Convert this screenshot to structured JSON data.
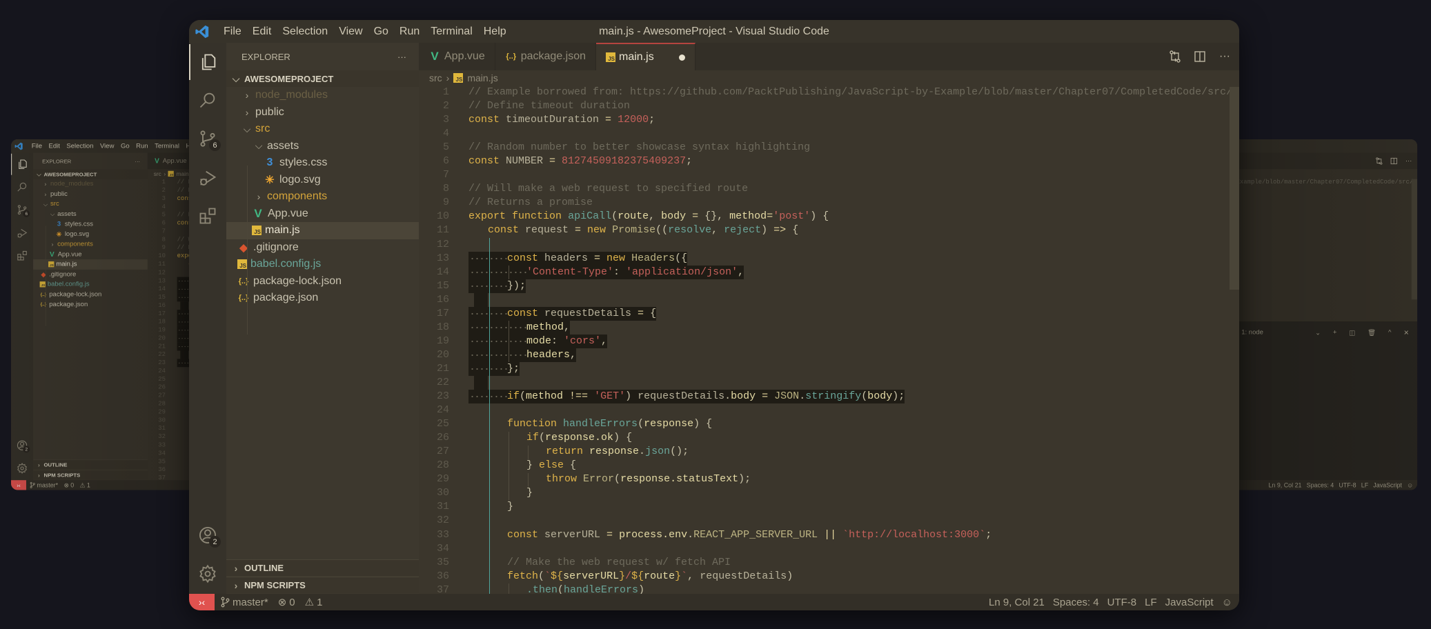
{
  "window": {
    "title": "main.js - AwesomeProject - Visual Studio Code",
    "menu": [
      "File",
      "Edit",
      "Selection",
      "View",
      "Go",
      "Run",
      "Terminal",
      "Help"
    ]
  },
  "activity_bar": {
    "items": [
      {
        "name": "explorer",
        "active": true
      },
      {
        "name": "search"
      },
      {
        "name": "source-control",
        "badge": "6"
      },
      {
        "name": "run-debug"
      },
      {
        "name": "extensions"
      }
    ],
    "account_badge": "2"
  },
  "sidebar": {
    "title": "EXPLORER",
    "more": "···",
    "project": "AWESOMEPROJECT",
    "tree": [
      {
        "label": "node_modules",
        "depth": 1,
        "kind": "folder",
        "expanded": false,
        "color": "#6b6045"
      },
      {
        "label": "public",
        "depth": 1,
        "kind": "folder",
        "expanded": false,
        "color": "#c9c3b0"
      },
      {
        "label": "src",
        "depth": 1,
        "kind": "folder",
        "expanded": true,
        "color": "#d4a43a"
      },
      {
        "label": "assets",
        "depth": 2,
        "kind": "folder",
        "expanded": true,
        "color": "#c9c3b0"
      },
      {
        "label": "styles.css",
        "depth": 3,
        "kind": "file",
        "icon": "css",
        "color": "#c9c3b0"
      },
      {
        "label": "logo.svg",
        "depth": 3,
        "kind": "file",
        "icon": "svg",
        "color": "#c9c3b0"
      },
      {
        "label": "components",
        "depth": 2,
        "kind": "folder",
        "expanded": false,
        "color": "#d4a43a"
      },
      {
        "label": "App.vue",
        "depth": 2,
        "kind": "file",
        "icon": "vue",
        "color": "#c9c3b0"
      },
      {
        "label": "main.js",
        "depth": 2,
        "kind": "file",
        "icon": "js",
        "color": "#ece6d4",
        "selected": true
      },
      {
        "label": ".gitignore",
        "depth": 1,
        "kind": "file",
        "icon": "git",
        "color": "#c9c3b0"
      },
      {
        "label": "babel.config.js",
        "depth": 1,
        "kind": "file",
        "icon": "js",
        "color": "#6aa69a"
      },
      {
        "label": "package-lock.json",
        "depth": 1,
        "kind": "file",
        "icon": "json",
        "color": "#c9c3b0"
      },
      {
        "label": "package.json",
        "depth": 1,
        "kind": "file",
        "icon": "json",
        "color": "#c9c3b0"
      }
    ],
    "sections": [
      "OUTLINE",
      "NPM SCRIPTS"
    ]
  },
  "tabs": [
    {
      "label": "App.vue",
      "icon": "vue"
    },
    {
      "label": "package.json",
      "icon": "json"
    },
    {
      "label": "main.js",
      "icon": "js",
      "active": true,
      "dirty": true
    }
  ],
  "breadcrumb": [
    "src",
    "main.js"
  ],
  "editor": {
    "lines": [
      {
        "n": "1",
        "i": 0,
        "t": [
          [
            "c",
            "// Example borrowed from: https://github.com/PacktPublishing/JavaScript-by-Example/blob/master/Chapter07/CompletedCode/src/se"
          ]
        ]
      },
      {
        "n": "2",
        "i": 0,
        "t": [
          [
            "c",
            "// Define timeout duration"
          ]
        ]
      },
      {
        "n": "3",
        "i": 0,
        "t": [
          [
            "k",
            "const"
          ],
          [
            "v",
            " timeoutDuration "
          ],
          [
            "o",
            "= "
          ],
          [
            "n",
            "12000"
          ],
          [
            "p",
            ";"
          ]
        ]
      },
      {
        "n": "4",
        "i": 0,
        "t": []
      },
      {
        "n": "5",
        "i": 0,
        "t": [
          [
            "c",
            "// Random number to better showcase syntax highlighting"
          ]
        ]
      },
      {
        "n": "6",
        "i": 0,
        "t": [
          [
            "k",
            "const"
          ],
          [
            "v",
            " NUMBER "
          ],
          [
            "o",
            "= "
          ],
          [
            "n",
            "81274509182375409237"
          ],
          [
            "p",
            ";"
          ]
        ]
      },
      {
        "n": "7",
        "i": 0,
        "t": []
      },
      {
        "n": "8",
        "i": 0,
        "t": [
          [
            "c",
            "// Will make a web request to specified route"
          ]
        ]
      },
      {
        "n": "9",
        "i": 0,
        "t": [
          [
            "c",
            "// Returns a promise"
          ]
        ]
      },
      {
        "n": "10",
        "i": 0,
        "t": [
          [
            "k",
            "export"
          ],
          [
            "p",
            " "
          ],
          [
            "k",
            "function"
          ],
          [
            "p",
            " "
          ],
          [
            "f",
            "apiCall"
          ],
          [
            "p",
            "("
          ],
          [
            "a",
            "route"
          ],
          [
            "p",
            ", "
          ],
          [
            "a",
            "body"
          ],
          [
            "o",
            " = "
          ],
          [
            "p",
            "{}, "
          ],
          [
            "a",
            "method"
          ],
          [
            "o",
            "="
          ],
          [
            "s",
            "'post'"
          ],
          [
            "p",
            ") {"
          ]
        ]
      },
      {
        "n": "11",
        "i": 1,
        "t": [
          [
            "k",
            "const"
          ],
          [
            "v",
            " request "
          ],
          [
            "o",
            "= "
          ],
          [
            "k",
            "new"
          ],
          [
            "p",
            " "
          ],
          [
            "t",
            "Promise"
          ],
          [
            "p",
            "(("
          ],
          [
            "f",
            "resolve"
          ],
          [
            "p",
            ", "
          ],
          [
            "f",
            "reject"
          ],
          [
            "p",
            ") "
          ],
          [
            "o",
            "=>"
          ],
          [
            "p",
            " {"
          ]
        ]
      },
      {
        "n": "12",
        "i": 0,
        "t": []
      },
      {
        "n": "13",
        "i": 2,
        "hl": true,
        "t": [
          [
            "k",
            "const"
          ],
          [
            "v",
            " headers "
          ],
          [
            "o",
            "= "
          ],
          [
            "k",
            "new"
          ],
          [
            "p",
            " "
          ],
          [
            "t",
            "Headers"
          ],
          [
            "p",
            "({"
          ]
        ]
      },
      {
        "n": "14",
        "i": 3,
        "hl": true,
        "t": [
          [
            "s",
            "'Content-Type'"
          ],
          [
            "p",
            ": "
          ],
          [
            "s",
            "'application/json'"
          ],
          [
            "p",
            ","
          ]
        ]
      },
      {
        "n": "15",
        "i": 2,
        "hl": true,
        "t": [
          [
            "p",
            "});"
          ]
        ]
      },
      {
        "n": "16",
        "i": 0,
        "strip": true,
        "t": []
      },
      {
        "n": "17",
        "i": 2,
        "hl": true,
        "t": [
          [
            "k",
            "const"
          ],
          [
            "v",
            " requestDetails "
          ],
          [
            "o",
            "= "
          ],
          [
            "p",
            "{"
          ]
        ]
      },
      {
        "n": "18",
        "i": 3,
        "hl": true,
        "t": [
          [
            "a",
            "method"
          ],
          [
            "p",
            ","
          ]
        ]
      },
      {
        "n": "19",
        "i": 3,
        "hl": true,
        "t": [
          [
            "a",
            "mode"
          ],
          [
            "p",
            ": "
          ],
          [
            "s",
            "'cors'"
          ],
          [
            "p",
            ","
          ]
        ]
      },
      {
        "n": "20",
        "i": 3,
        "hl": true,
        "t": [
          [
            "a",
            "headers"
          ],
          [
            "p",
            ","
          ]
        ]
      },
      {
        "n": "21",
        "i": 2,
        "hl": true,
        "t": [
          [
            "p",
            "};"
          ]
        ]
      },
      {
        "n": "22",
        "i": 0,
        "strip": true,
        "t": []
      },
      {
        "n": "23",
        "i": 2,
        "hl": true,
        "t": [
          [
            "k",
            "if"
          ],
          [
            "p",
            "("
          ],
          [
            "a",
            "method"
          ],
          [
            "o",
            " !== "
          ],
          [
            "s",
            "'GET'"
          ],
          [
            "p",
            ") "
          ],
          [
            "v",
            "requestDetails"
          ],
          [
            "p",
            "."
          ],
          [
            "a",
            "body"
          ],
          [
            "o",
            " = "
          ],
          [
            "t",
            "JSON"
          ],
          [
            "p",
            "."
          ],
          [
            "f",
            "stringify"
          ],
          [
            "p",
            "("
          ],
          [
            "a",
            "body"
          ],
          [
            "p",
            ");"
          ]
        ]
      },
      {
        "n": "24",
        "i": 0,
        "t": []
      },
      {
        "n": "25",
        "i": 2,
        "t": [
          [
            "k",
            "function"
          ],
          [
            "p",
            " "
          ],
          [
            "f",
            "handleErrors"
          ],
          [
            "p",
            "("
          ],
          [
            "a",
            "response"
          ],
          [
            "p",
            ") {"
          ]
        ]
      },
      {
        "n": "26",
        "i": 3,
        "t": [
          [
            "k",
            "if"
          ],
          [
            "p",
            "("
          ],
          [
            "a",
            "response.ok"
          ],
          [
            "p",
            ") {"
          ]
        ]
      },
      {
        "n": "27",
        "i": 4,
        "t": [
          [
            "k",
            "return"
          ],
          [
            "p",
            " "
          ],
          [
            "a",
            "response"
          ],
          [
            "p",
            "."
          ],
          [
            "f",
            "json"
          ],
          [
            "p",
            "();"
          ]
        ]
      },
      {
        "n": "28",
        "i": 3,
        "t": [
          [
            "p",
            "} "
          ],
          [
            "k",
            "else"
          ],
          [
            "p",
            " {"
          ]
        ]
      },
      {
        "n": "29",
        "i": 4,
        "t": [
          [
            "k",
            "throw"
          ],
          [
            "p",
            " "
          ],
          [
            "t",
            "Error"
          ],
          [
            "p",
            "("
          ],
          [
            "a",
            "response.statusText"
          ],
          [
            "p",
            ");"
          ]
        ]
      },
      {
        "n": "30",
        "i": 3,
        "t": [
          [
            "p",
            "}"
          ]
        ]
      },
      {
        "n": "31",
        "i": 2,
        "t": [
          [
            "p",
            "}"
          ]
        ]
      },
      {
        "n": "32",
        "i": 0,
        "t": []
      },
      {
        "n": "33",
        "i": 2,
        "t": [
          [
            "k",
            "const"
          ],
          [
            "v",
            " serverURL "
          ],
          [
            "o",
            "= "
          ],
          [
            "a",
            "process.env"
          ],
          [
            "p",
            "."
          ],
          [
            "t",
            "REACT_APP_SERVER_URL"
          ],
          [
            "o",
            " || "
          ],
          [
            "s",
            "`http://localhost:3000`"
          ],
          [
            "p",
            ";"
          ]
        ]
      },
      {
        "n": "34",
        "i": 0,
        "t": []
      },
      {
        "n": "35",
        "i": 2,
        "t": [
          [
            "c",
            "// Make the web request w/ fetch API"
          ]
        ]
      },
      {
        "n": "36",
        "i": 2,
        "t": [
          [
            "k",
            "fetch"
          ],
          [
            "p",
            "("
          ],
          [
            "s",
            "`"
          ],
          [
            "k",
            "${"
          ],
          [
            "a",
            "serverURL"
          ],
          [
            "k",
            "}"
          ],
          [
            "s",
            "/"
          ],
          [
            "k",
            "${"
          ],
          [
            "a",
            "route"
          ],
          [
            "k",
            "}"
          ],
          [
            "s",
            "`"
          ],
          [
            "p",
            ", "
          ],
          [
            "v",
            "requestDetails"
          ],
          [
            "p",
            ")"
          ]
        ]
      },
      {
        "n": "37",
        "i": 3,
        "t": [
          [
            "f",
            ".then"
          ],
          [
            "p",
            "("
          ],
          [
            "f",
            "handleErrors"
          ],
          [
            "p",
            ")"
          ]
        ]
      }
    ]
  },
  "terminal": {
    "tab": "1: node"
  },
  "status_bar": {
    "branch": "master*",
    "errors": "0",
    "warnings": "1",
    "position": "Ln 9, Col 21",
    "spaces": "Spaces: 4",
    "encoding": "UTF-8",
    "eol": "LF",
    "language": "JavaScript"
  },
  "colors": {
    "page_background": "#15151d",
    "editor_background": "#3b362c",
    "accent_remote": "#e0524f",
    "active_tab_border": "#b5443f",
    "indent_guide_active": "#4fa59c"
  }
}
